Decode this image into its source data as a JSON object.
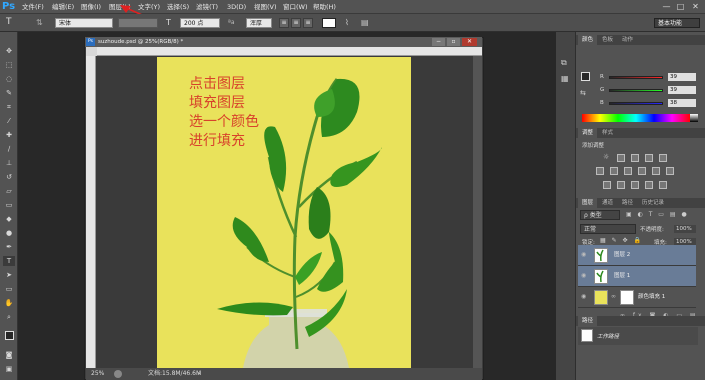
{
  "app": {
    "logo": "Ps"
  },
  "menu": [
    "文件(F)",
    "编辑(E)",
    "图像(I)",
    "图层(L)",
    "文字(Y)",
    "选择(S)",
    "滤镜(T)",
    "3D(D)",
    "视图(V)",
    "窗口(W)",
    "帮助(H)"
  ],
  "window_controls": [
    "—",
    "□",
    "✕"
  ],
  "options": {
    "font_family": "宋体",
    "font_size": "200 点",
    "antialias": "浑厚",
    "workspace": "基本功能"
  },
  "document": {
    "tab_title": "suzhoude.psd @ 25%(RGB/8) *",
    "zoom": "25%",
    "doc_info": "文档:15.8M/46.6M",
    "canvas_text": [
      "点击图层",
      "填充图层",
      "选一个颜色",
      "进行填充"
    ],
    "colors": {
      "canvas": "#e9e25b",
      "text": "#d8422b"
    }
  },
  "color_panel": {
    "tabs": [
      "颜色",
      "色板",
      "动作"
    ],
    "channels": [
      {
        "label": "R",
        "value": "39",
        "color": "#d33"
      },
      {
        "label": "G",
        "value": "39",
        "color": "#3a3"
      },
      {
        "label": "B",
        "value": "38",
        "color": "#33d"
      }
    ]
  },
  "adjustments_panel": {
    "tabs": [
      "调整",
      "样式"
    ],
    "title": "添加调整"
  },
  "layers_panel": {
    "tabs": [
      "图层",
      "通道",
      "路径",
      "历史记录"
    ],
    "filter_label": "ρ 类型",
    "blend_mode": "正常",
    "opacity_label": "不透明度:",
    "opacity": "100%",
    "lock_label": "锁定:",
    "fill_label": "填充:",
    "fill": "100%",
    "layers": [
      {
        "name": "图层 2",
        "selected": true
      },
      {
        "name": "图层 1",
        "selected": true
      },
      {
        "name": "颜色填充 1",
        "selected": false
      }
    ]
  },
  "paths_panel": {
    "title": "路径",
    "item": "工作路径"
  }
}
